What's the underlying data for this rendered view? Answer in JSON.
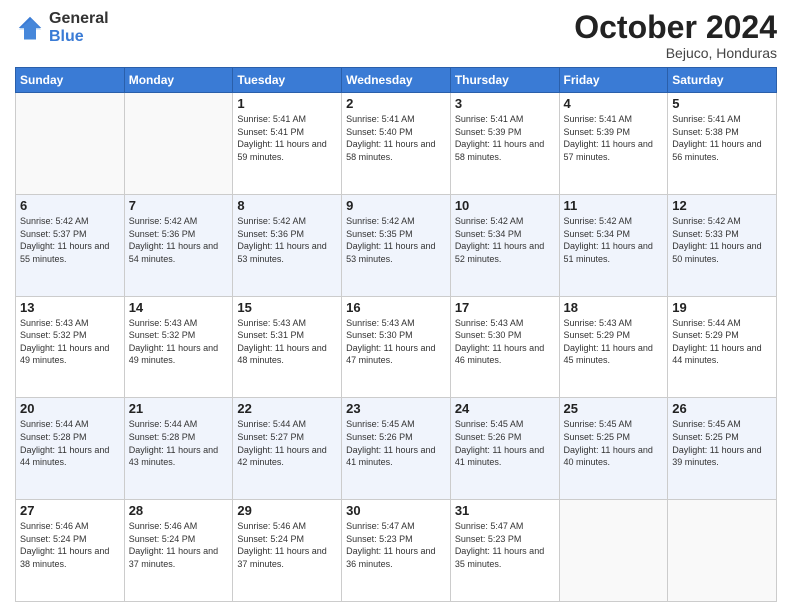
{
  "header": {
    "logo_general": "General",
    "logo_blue": "Blue",
    "month": "October 2024",
    "location": "Bejuco, Honduras"
  },
  "days_of_week": [
    "Sunday",
    "Monday",
    "Tuesday",
    "Wednesday",
    "Thursday",
    "Friday",
    "Saturday"
  ],
  "weeks": [
    [
      {
        "day": "",
        "info": ""
      },
      {
        "day": "",
        "info": ""
      },
      {
        "day": "1",
        "info": "Sunrise: 5:41 AM\nSunset: 5:41 PM\nDaylight: 11 hours and 59 minutes."
      },
      {
        "day": "2",
        "info": "Sunrise: 5:41 AM\nSunset: 5:40 PM\nDaylight: 11 hours and 58 minutes."
      },
      {
        "day": "3",
        "info": "Sunrise: 5:41 AM\nSunset: 5:39 PM\nDaylight: 11 hours and 58 minutes."
      },
      {
        "day": "4",
        "info": "Sunrise: 5:41 AM\nSunset: 5:39 PM\nDaylight: 11 hours and 57 minutes."
      },
      {
        "day": "5",
        "info": "Sunrise: 5:41 AM\nSunset: 5:38 PM\nDaylight: 11 hours and 56 minutes."
      }
    ],
    [
      {
        "day": "6",
        "info": "Sunrise: 5:42 AM\nSunset: 5:37 PM\nDaylight: 11 hours and 55 minutes."
      },
      {
        "day": "7",
        "info": "Sunrise: 5:42 AM\nSunset: 5:36 PM\nDaylight: 11 hours and 54 minutes."
      },
      {
        "day": "8",
        "info": "Sunrise: 5:42 AM\nSunset: 5:36 PM\nDaylight: 11 hours and 53 minutes."
      },
      {
        "day": "9",
        "info": "Sunrise: 5:42 AM\nSunset: 5:35 PM\nDaylight: 11 hours and 53 minutes."
      },
      {
        "day": "10",
        "info": "Sunrise: 5:42 AM\nSunset: 5:34 PM\nDaylight: 11 hours and 52 minutes."
      },
      {
        "day": "11",
        "info": "Sunrise: 5:42 AM\nSunset: 5:34 PM\nDaylight: 11 hours and 51 minutes."
      },
      {
        "day": "12",
        "info": "Sunrise: 5:42 AM\nSunset: 5:33 PM\nDaylight: 11 hours and 50 minutes."
      }
    ],
    [
      {
        "day": "13",
        "info": "Sunrise: 5:43 AM\nSunset: 5:32 PM\nDaylight: 11 hours and 49 minutes."
      },
      {
        "day": "14",
        "info": "Sunrise: 5:43 AM\nSunset: 5:32 PM\nDaylight: 11 hours and 49 minutes."
      },
      {
        "day": "15",
        "info": "Sunrise: 5:43 AM\nSunset: 5:31 PM\nDaylight: 11 hours and 48 minutes."
      },
      {
        "day": "16",
        "info": "Sunrise: 5:43 AM\nSunset: 5:30 PM\nDaylight: 11 hours and 47 minutes."
      },
      {
        "day": "17",
        "info": "Sunrise: 5:43 AM\nSunset: 5:30 PM\nDaylight: 11 hours and 46 minutes."
      },
      {
        "day": "18",
        "info": "Sunrise: 5:43 AM\nSunset: 5:29 PM\nDaylight: 11 hours and 45 minutes."
      },
      {
        "day": "19",
        "info": "Sunrise: 5:44 AM\nSunset: 5:29 PM\nDaylight: 11 hours and 44 minutes."
      }
    ],
    [
      {
        "day": "20",
        "info": "Sunrise: 5:44 AM\nSunset: 5:28 PM\nDaylight: 11 hours and 44 minutes."
      },
      {
        "day": "21",
        "info": "Sunrise: 5:44 AM\nSunset: 5:28 PM\nDaylight: 11 hours and 43 minutes."
      },
      {
        "day": "22",
        "info": "Sunrise: 5:44 AM\nSunset: 5:27 PM\nDaylight: 11 hours and 42 minutes."
      },
      {
        "day": "23",
        "info": "Sunrise: 5:45 AM\nSunset: 5:26 PM\nDaylight: 11 hours and 41 minutes."
      },
      {
        "day": "24",
        "info": "Sunrise: 5:45 AM\nSunset: 5:26 PM\nDaylight: 11 hours and 41 minutes."
      },
      {
        "day": "25",
        "info": "Sunrise: 5:45 AM\nSunset: 5:25 PM\nDaylight: 11 hours and 40 minutes."
      },
      {
        "day": "26",
        "info": "Sunrise: 5:45 AM\nSunset: 5:25 PM\nDaylight: 11 hours and 39 minutes."
      }
    ],
    [
      {
        "day": "27",
        "info": "Sunrise: 5:46 AM\nSunset: 5:24 PM\nDaylight: 11 hours and 38 minutes."
      },
      {
        "day": "28",
        "info": "Sunrise: 5:46 AM\nSunset: 5:24 PM\nDaylight: 11 hours and 37 minutes."
      },
      {
        "day": "29",
        "info": "Sunrise: 5:46 AM\nSunset: 5:24 PM\nDaylight: 11 hours and 37 minutes."
      },
      {
        "day": "30",
        "info": "Sunrise: 5:47 AM\nSunset: 5:23 PM\nDaylight: 11 hours and 36 minutes."
      },
      {
        "day": "31",
        "info": "Sunrise: 5:47 AM\nSunset: 5:23 PM\nDaylight: 11 hours and 35 minutes."
      },
      {
        "day": "",
        "info": ""
      },
      {
        "day": "",
        "info": ""
      }
    ]
  ]
}
